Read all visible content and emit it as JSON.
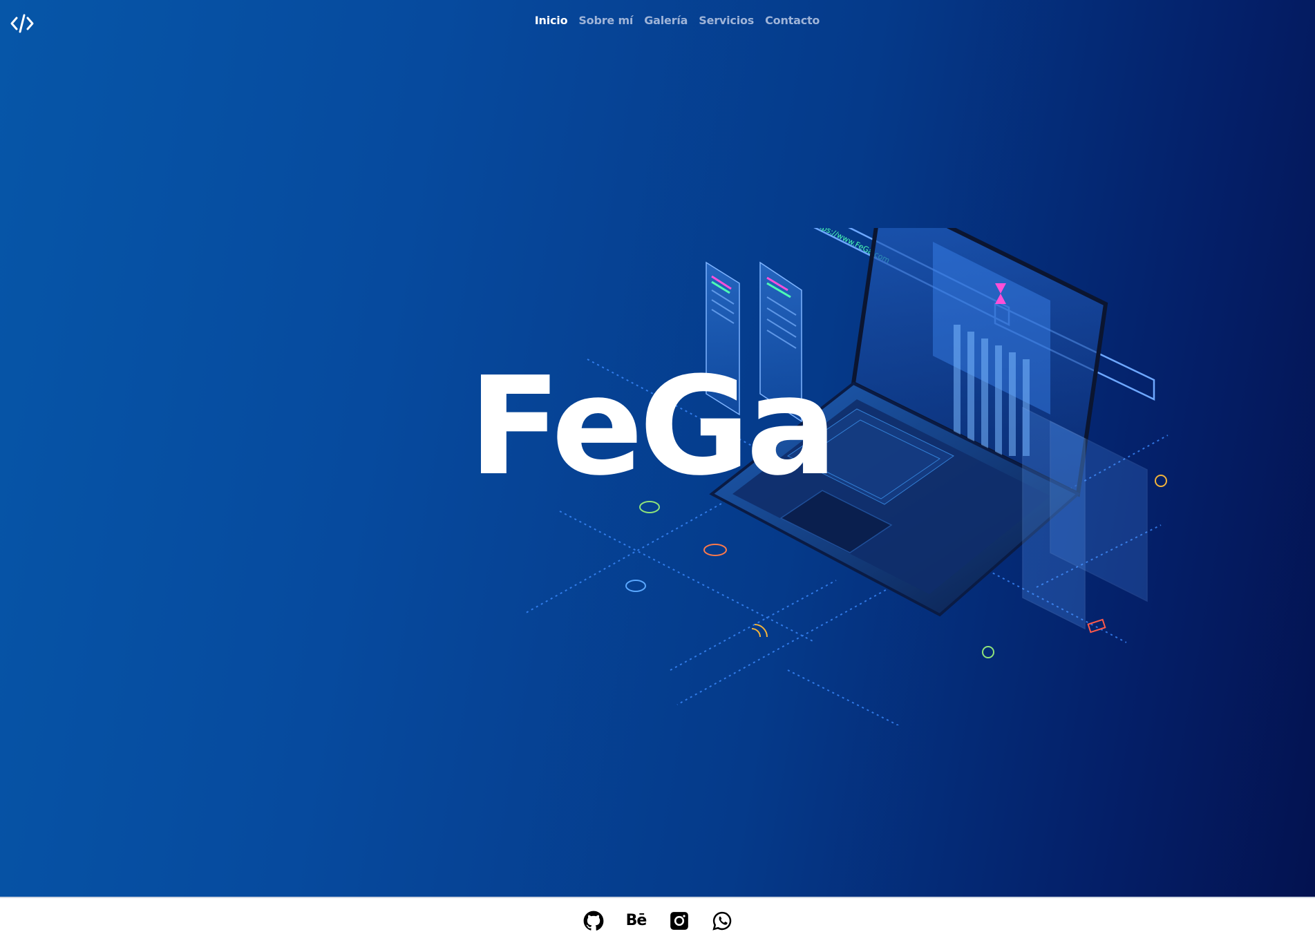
{
  "header": {
    "logo_icon": "code-brackets-icon",
    "nav": [
      {
        "label": "Inicio",
        "active": true
      },
      {
        "label": "Sobre mí",
        "active": false
      },
      {
        "label": "Galería",
        "active": false
      },
      {
        "label": "Servicios",
        "active": false
      },
      {
        "label": "Contacto",
        "active": false
      }
    ]
  },
  "hero": {
    "brand": "FeGa",
    "illustration": "isometric-laptop-illustration",
    "browser_url": "https://www.FeGa.com"
  },
  "footer": {
    "social": [
      {
        "icon": "github-icon"
      },
      {
        "icon": "behance-icon",
        "label": "Bē"
      },
      {
        "icon": "instagram-icon"
      },
      {
        "icon": "whatsapp-icon"
      }
    ]
  },
  "colors": {
    "hero_gradient_start": "#0656a8",
    "hero_gradient_end": "#031250",
    "nav_active": "#ffffff",
    "nav_inactive": "#9fb4d8",
    "footer_bg": "#ffffff"
  }
}
